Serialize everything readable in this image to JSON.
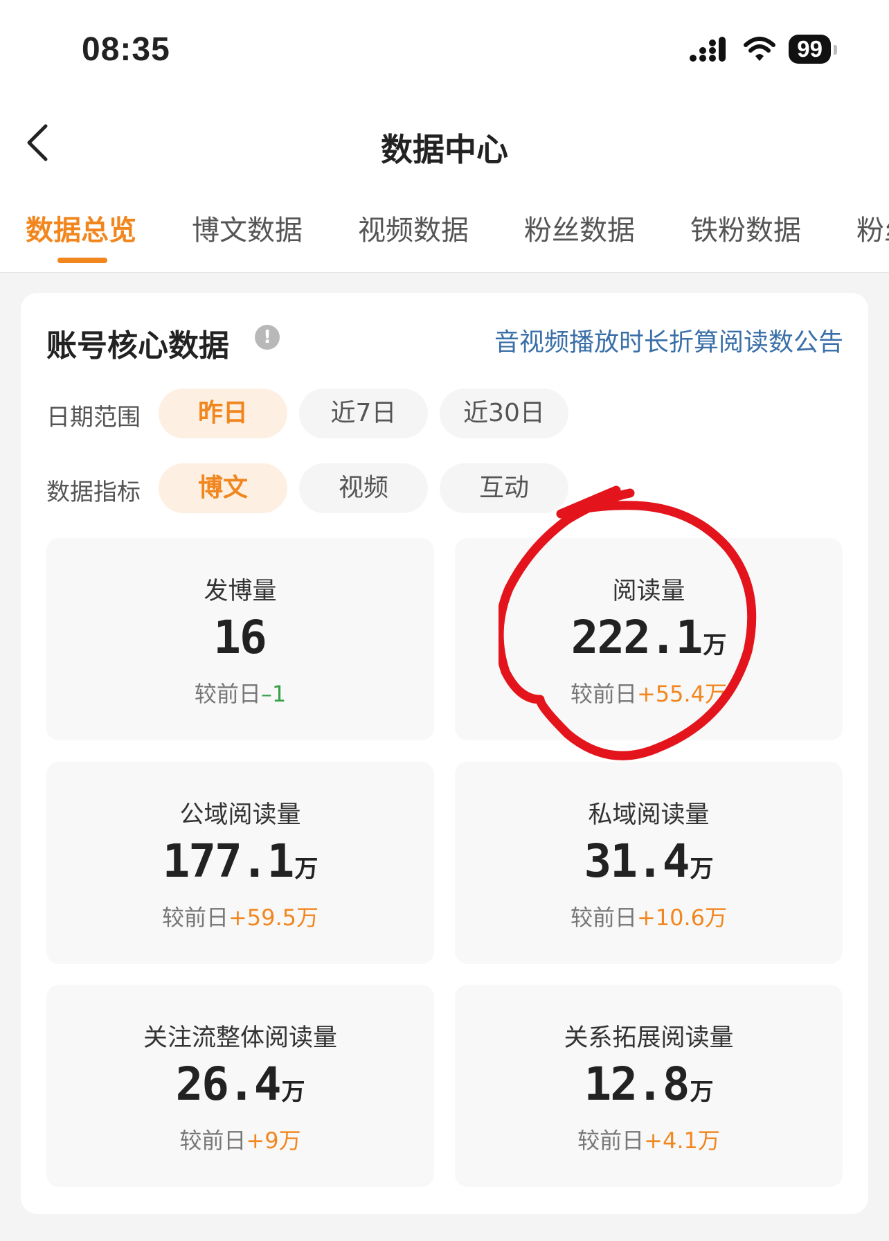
{
  "status_bar": {
    "time": "08:35",
    "battery": "99"
  },
  "nav": {
    "title": "数据中心"
  },
  "tabs": [
    "数据总览",
    "博文数据",
    "视频数据",
    "粉丝数据",
    "铁粉数据",
    "粉丝"
  ],
  "section": {
    "title": "账号核心数据",
    "notice": "音视频播放时长折算阅读数公告"
  },
  "filters": {
    "date": {
      "label": "日期范围",
      "options": [
        "昨日",
        "近7日",
        "近30日"
      ],
      "selected": "昨日"
    },
    "metric": {
      "label": "数据指标",
      "options": [
        "博文",
        "视频",
        "互动"
      ],
      "selected": "博文"
    }
  },
  "delta_prefix": "较前日",
  "metrics": [
    {
      "label": "发博量",
      "value": "16",
      "unit": "",
      "delta": "–1",
      "trend": "down"
    },
    {
      "label": "阅读量",
      "value": "222.1",
      "unit": "万",
      "delta": "+55.4万",
      "trend": "up"
    },
    {
      "label": "公域阅读量",
      "value": "177.1",
      "unit": "万",
      "delta": "+59.5万",
      "trend": "up"
    },
    {
      "label": "私域阅读量",
      "value": "31.4",
      "unit": "万",
      "delta": "+10.6万",
      "trend": "up"
    },
    {
      "label": "关注流整体阅读量",
      "value": "26.4",
      "unit": "万",
      "delta": "+9万",
      "trend": "up"
    },
    {
      "label": "关系拓展阅读量",
      "value": "12.8",
      "unit": "万",
      "delta": "+4.1万",
      "trend": "up"
    }
  ],
  "colors": {
    "accent": "#f2861e",
    "link": "#3a6fa8",
    "negative": "#37a04a",
    "annotation": "#e3141b"
  }
}
